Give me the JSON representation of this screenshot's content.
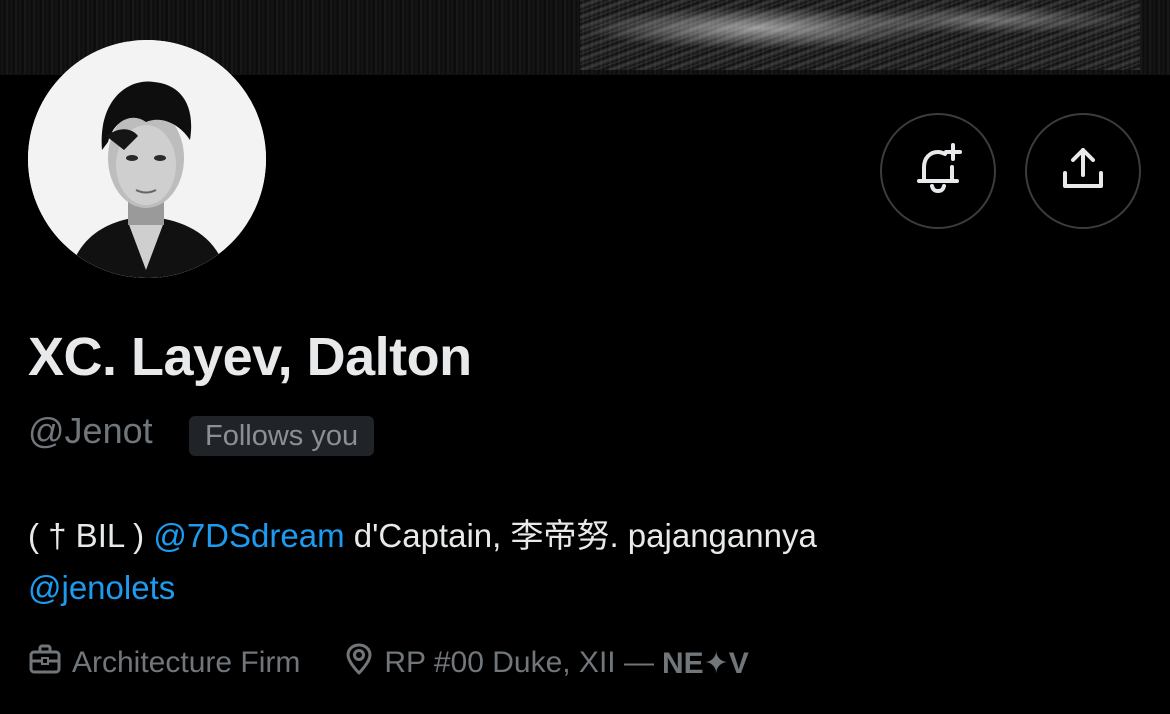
{
  "profile": {
    "display_name": "XC. Layev, Dalton",
    "handle": "@Jenot",
    "follows_badge": "Follows you"
  },
  "bio": {
    "prefix": "( † BIL ) ",
    "mention_1": "@7DSdream",
    "middle": " d'Captain, 李帝努. pajangannya",
    "mention_2": "@jenolets"
  },
  "meta": {
    "category": "Architecture Firm",
    "location": "RP #00 Duke, XII —",
    "location_suffix": "NE✦V"
  },
  "icons": {
    "notify": "bell-plus-icon",
    "share": "share-upload-icon",
    "category": "briefcase-icon",
    "location": "location-pin-icon"
  },
  "colors": {
    "background": "#000000",
    "text_primary": "#e7e9ea",
    "text_secondary": "#71767b",
    "link": "#1d9bf0",
    "badge_bg": "#202327",
    "button_border": "#3a3d40"
  }
}
